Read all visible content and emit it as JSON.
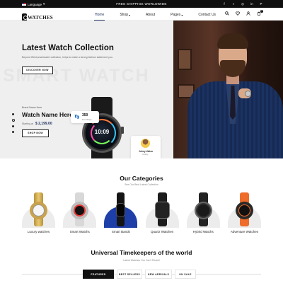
{
  "topbar": {
    "language": "Language",
    "promo": "FREE SHIPPING WORLDWIDE",
    "social": [
      "f",
      "t",
      "◎",
      "in",
      "P"
    ]
  },
  "header": {
    "logo_text": "WATCHES",
    "logo_sub": "WATCHES STORE",
    "nav": [
      {
        "label": "Home",
        "caret": ""
      },
      {
        "label": "Shop",
        "caret": "▾"
      },
      {
        "label": "About",
        "caret": ""
      },
      {
        "label": "Pages",
        "caret": "▾"
      },
      {
        "label": "Contact Us",
        "caret": ""
      }
    ],
    "cart_count": "0"
  },
  "hero": {
    "bg_text": "SMART WATCH",
    "title": "Latest Watch Collection",
    "subtitle": "Beyond Wrist,smartwatch collection, helps to make a strong fashion statement you.",
    "cta": "DISCOVER NOW",
    "brand": "Brand Name Here",
    "watch_name": "Watch Name Here",
    "price_label": "Starting at",
    "price": "$ 2,199.00",
    "shop_btn": "SHOP NOW",
    "watch_time": "10:09",
    "steps_value": "350",
    "steps_label": "Foot Steps",
    "caller_name": "Johny Vatica",
    "caller_sub": "Calling..."
  },
  "categories": {
    "title": "Our Categories",
    "subtitle": "See Our Best Latest Collection",
    "items": [
      {
        "label": "Luxury watches"
      },
      {
        "label": "Smart Watchs"
      },
      {
        "label": "Smart Bands"
      },
      {
        "label": "Quartz Watches"
      },
      {
        "label": "Hybrid Watchs"
      },
      {
        "label": "Adventure Watches"
      }
    ]
  },
  "timekeepers": {
    "title": "Universal Timekeepers of the world",
    "subtitle": "Latest Watches You Can't Resist!",
    "tabs": [
      "FEATURED",
      "BEST SELLERS",
      "NEW ARRIVALS",
      "ON SALE"
    ]
  },
  "colors": {
    "topbar": "#0f0f0f",
    "accent_navy": "#1a2e5a",
    "hero_bg": "#efefef"
  }
}
